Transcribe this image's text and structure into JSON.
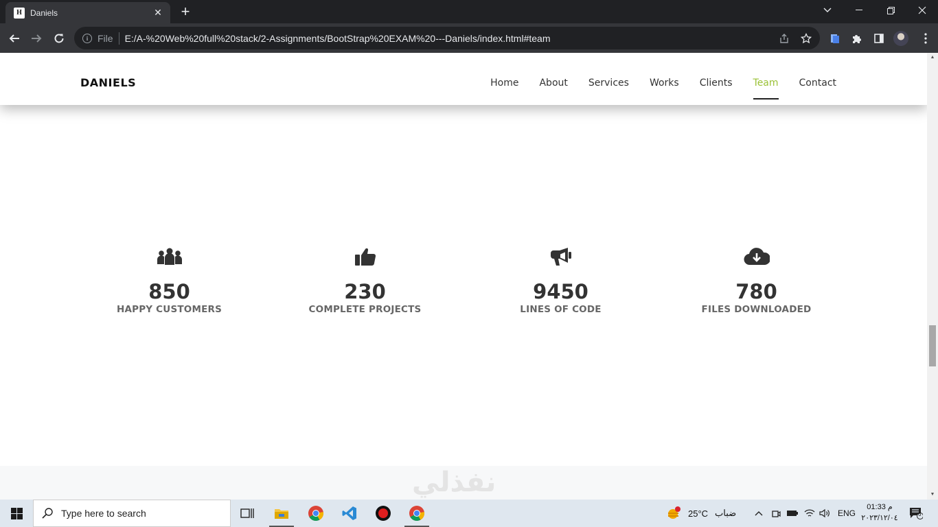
{
  "browser": {
    "tab_title": "Daniels",
    "tab_favicon": "H",
    "address_scheme": "File",
    "address_url": "E:/A-%20Web%20full%20stack/2-Assignments/BootStrap%20EXAM%20---Daniels/index.html#team"
  },
  "site": {
    "brand": "DANIELS",
    "nav": [
      {
        "label": "Home"
      },
      {
        "label": "About"
      },
      {
        "label": "Services"
      },
      {
        "label": "Works"
      },
      {
        "label": "Clients"
      },
      {
        "label": "Team",
        "active": true
      },
      {
        "label": "Contact"
      }
    ],
    "active_color": "#9ac136",
    "stats": [
      {
        "icon": "users-icon",
        "number": "850",
        "label": "HAPPY CUSTOMERS"
      },
      {
        "icon": "thumbs-up-icon",
        "number": "230",
        "label": "COMPLETE PROJECTS"
      },
      {
        "icon": "megaphone-icon",
        "number": "9450",
        "label": "LINES OF CODE"
      },
      {
        "icon": "cloud-download-icon",
        "number": "780",
        "label": "FILES DOWNLOADED"
      }
    ],
    "watermark": "نفذلي"
  },
  "taskbar": {
    "search_placeholder": "Type here to search",
    "weather_temp": "25°C",
    "weather_text": "ضباب",
    "language": "ENG",
    "time": "01:33 م",
    "date": "٢٠٢٣/١٢/٠٤",
    "notification_count": "6"
  }
}
